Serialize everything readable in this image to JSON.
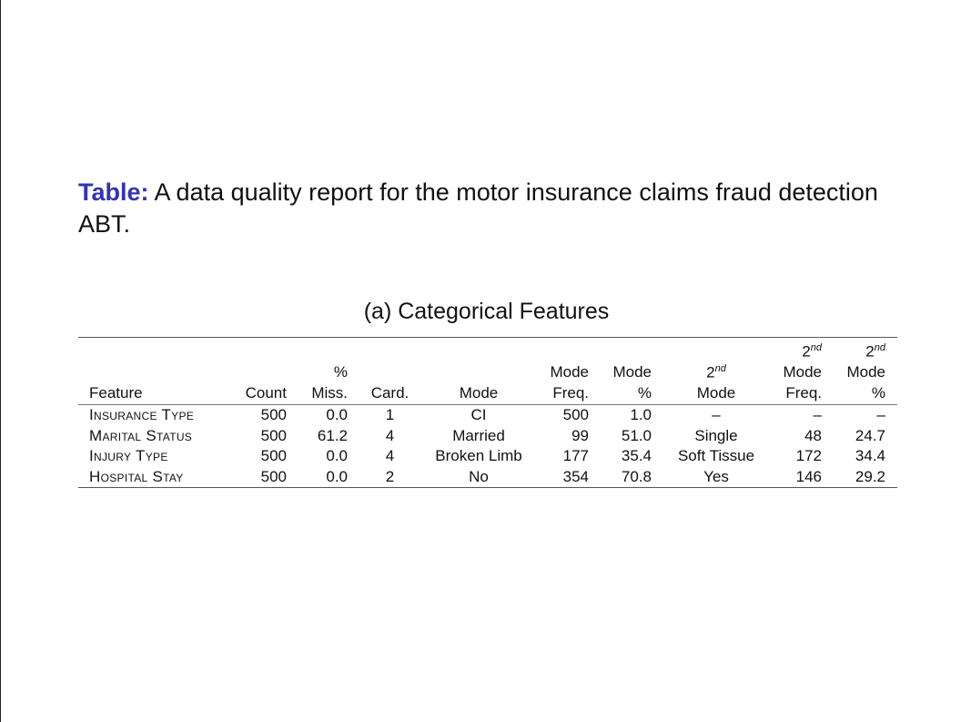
{
  "caption": {
    "label": "Table:",
    "text": "A data quality report for the motor insurance claims fraud detection ABT."
  },
  "subcaption": "(a)  Categorical Features",
  "table": {
    "headers": [
      {
        "lines": [
          "Feature"
        ]
      },
      {
        "lines": [
          "Count"
        ]
      },
      {
        "lines": [
          "%",
          "Miss."
        ]
      },
      {
        "lines": [
          "Card."
        ]
      },
      {
        "lines": [
          "Mode"
        ]
      },
      {
        "lines": [
          "Mode",
          "Freq."
        ]
      },
      {
        "lines": [
          "Mode",
          "%"
        ]
      },
      {
        "lines": [
          "2",
          "nd",
          "Mode"
        ]
      },
      {
        "lines": [
          "2",
          "nd",
          "Mode",
          "Freq."
        ]
      },
      {
        "lines": [
          "2",
          "nd",
          "Mode",
          "%"
        ]
      }
    ],
    "rows": [
      [
        "Insurance Type",
        "500",
        "0.0",
        "1",
        "CI",
        "500",
        "1.0",
        "–",
        "–",
        "–"
      ],
      [
        "Marital Status",
        "500",
        "61.2",
        "4",
        "Married",
        "99",
        "51.0",
        "Single",
        "48",
        "24.7"
      ],
      [
        "Injury Type",
        "500",
        "0.0",
        "4",
        "Broken Limb",
        "177",
        "35.4",
        "Soft Tissue",
        "172",
        "34.4"
      ],
      [
        "Hospital Stay",
        "500",
        "0.0",
        "2",
        "No",
        "354",
        "70.8",
        "Yes",
        "146",
        "29.2"
      ]
    ]
  }
}
